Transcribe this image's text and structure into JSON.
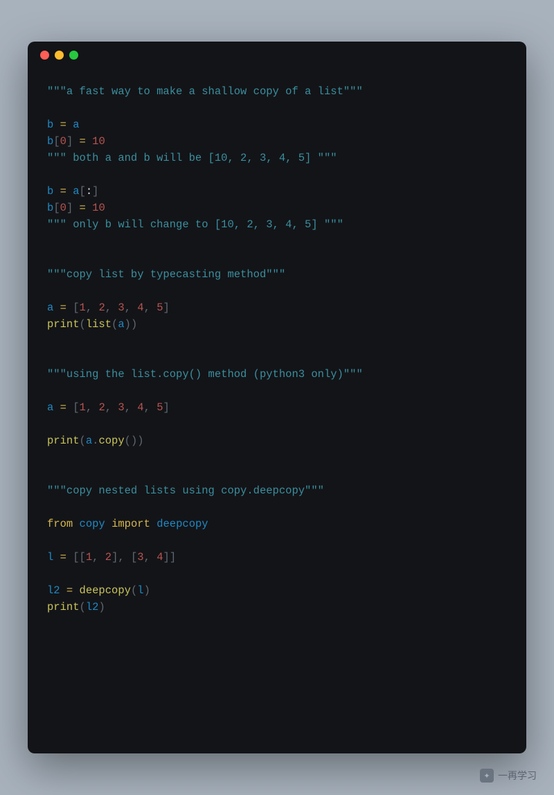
{
  "code": {
    "comment1": "\"\"\"a fast way to make a shallow copy of a list\"\"\"",
    "l1_b": "b",
    "l1_eq": " = ",
    "l1_a": "a",
    "l2_b": "b",
    "l2_lb": "[",
    "l2_0": "0",
    "l2_rb": "]",
    "l2_eq": " = ",
    "l2_10": "10",
    "comment2_a": "\"\"\" both a and b will be [10, 2, 3, 4, 5] \"\"\"",
    "l3_b": "b",
    "l3_eq": " = ",
    "l3_a": "a",
    "l3_lb": "[",
    "l3_colon": ":",
    "l3_rb": "]",
    "l4_b": "b",
    "l4_lb": "[",
    "l4_0": "0",
    "l4_rb": "]",
    "l4_eq": " = ",
    "l4_10": "10",
    "comment3": "\"\"\" only b will change to [10, 2, 3, 4, 5] \"\"\"",
    "comment4": "\"\"\"copy list by typecasting method\"\"\"",
    "l5_a": "a",
    "l5_eq": " = ",
    "l5_lb": "[",
    "l5_1": "1",
    "l5_c1": ", ",
    "l5_2": "2",
    "l5_c2": ", ",
    "l5_3": "3",
    "l5_c3": ", ",
    "l5_4": "4",
    "l5_c4": ", ",
    "l5_5": "5",
    "l5_rb": "]",
    "l6_print": "print",
    "l6_lp": "(",
    "l6_list": "list",
    "l6_lp2": "(",
    "l6_a": "a",
    "l6_rp": "))",
    "comment5": "\"\"\"using the list.copy() method (python3 only)\"\"\"",
    "l7_a": "a",
    "l7_eq": " = ",
    "l7_lb": "[",
    "l7_1": "1",
    "l7_c1": ", ",
    "l7_2": "2",
    "l7_c2": ", ",
    "l7_3": "3",
    "l7_c3": ", ",
    "l7_4": "4",
    "l7_c4": ", ",
    "l7_5": "5",
    "l7_rb": "]",
    "l8_print": "print",
    "l8_lp": "(",
    "l8_a": "a",
    "l8_dot": ".",
    "l8_copy": "copy",
    "l8_rp": "())",
    "comment6": "\"\"\"copy nested lists using copy.deepcopy\"\"\"",
    "l9_from": "from",
    "l9_sp1": " ",
    "l9_copy": "copy",
    "l9_sp2": " ",
    "l9_import": "import",
    "l9_sp3": " ",
    "l9_deepcopy": "deepcopy",
    "l10_l": "l",
    "l10_eq": " = ",
    "l10_lb": "[[",
    "l10_1": "1",
    "l10_c1": ", ",
    "l10_2": "2",
    "l10_rb1": "]",
    "l10_c2": ", ",
    "l10_lb2": "[",
    "l10_3": "3",
    "l10_c3": ", ",
    "l10_4": "4",
    "l10_rb": "]]",
    "l11_l2": "l2",
    "l11_eq": " = ",
    "l11_dc": "deepcopy",
    "l11_lp": "(",
    "l11_l": "l",
    "l11_rp": ")",
    "l12_print": "print",
    "l12_lp": "(",
    "l12_l2": "l2",
    "l12_rp": ")"
  },
  "watermark": {
    "text": "一再学习"
  }
}
